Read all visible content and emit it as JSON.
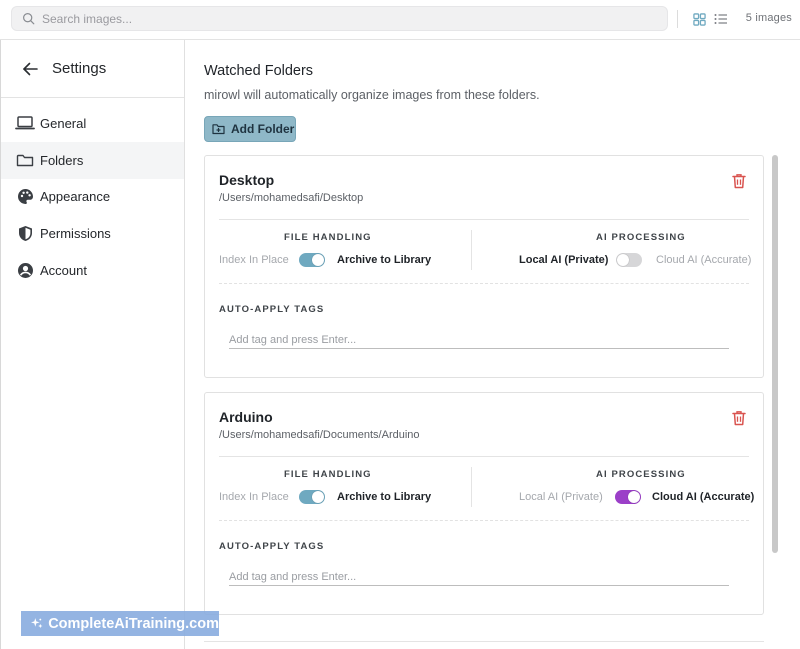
{
  "search": {
    "placeholder": "Search images..."
  },
  "topbar": {
    "image_count": "5 images"
  },
  "sidebar": {
    "title": "Settings",
    "items": [
      {
        "label": "General",
        "icon": "laptop-icon",
        "active": false
      },
      {
        "label": "Folders",
        "icon": "folder-icon",
        "active": true
      },
      {
        "label": "Appearance",
        "icon": "palette-icon",
        "active": false
      },
      {
        "label": "Permissions",
        "icon": "shield-icon",
        "active": false
      },
      {
        "label": "Account",
        "icon": "user-circle-icon",
        "active": false
      }
    ]
  },
  "main": {
    "title": "Watched Folders",
    "subtitle": "mirowl will automatically organize images from these folders.",
    "add_folder_label": "Add Folder",
    "labels": {
      "file_handling": "FILE HANDLING",
      "ai_processing": "AI PROCESSING",
      "auto_apply_tags": "AUTO-APPLY TAGS",
      "index_in_place": "Index In Place",
      "archive_to_library": "Archive to Library",
      "local_ai": "Local AI (Private)",
      "cloud_ai": "Cloud AI (Accurate)",
      "tag_placeholder": "Add tag and press Enter..."
    },
    "folders": [
      {
        "name": "Desktop",
        "path": "/Users/mohamedsafi/Desktop",
        "archive_to_library": true,
        "cloud_ai": false
      },
      {
        "name": "Arduino",
        "path": "/Users/mohamedsafi/Documents/Arduino",
        "archive_to_library": true,
        "cloud_ai": true
      }
    ]
  },
  "watermark": {
    "text": "CompleteAiTraining.com"
  },
  "colors": {
    "accent_teal": "#6fa9c0",
    "accent_purple": "#9b3fc8",
    "danger_red": "#d9534f",
    "button_bg": "#8fb8c8",
    "watermark_bg": "#85aade"
  }
}
